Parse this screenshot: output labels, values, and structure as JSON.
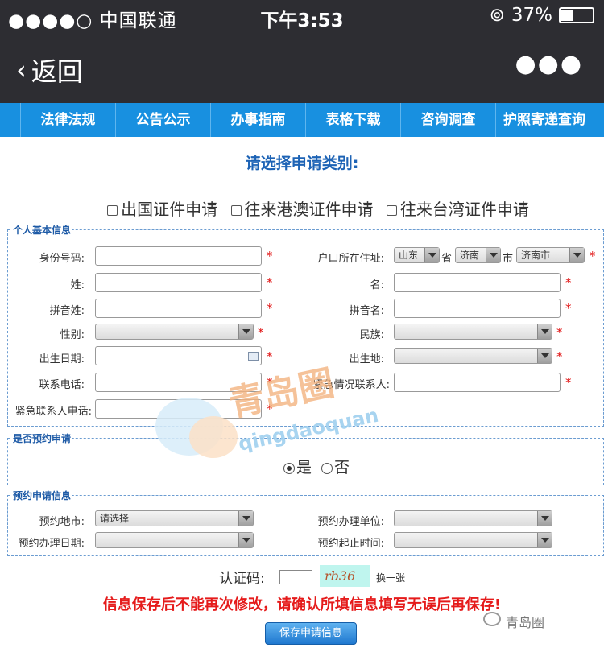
{
  "status": {
    "carrier": "●●●●○ 中国联通",
    "time": "下午3:53",
    "battery": "37%",
    "battery_level": 0.37
  },
  "nav": {
    "back_label": "返回",
    "more_label": "●●●"
  },
  "menu": [
    "法律法规",
    "公告公示",
    "办事指南",
    "表格下载",
    "咨询调查",
    "护照寄递查询"
  ],
  "page_title": "请选择申请类别:",
  "types": [
    "出国证件申请",
    "往来港澳证件申请",
    "往来台湾证件申请"
  ],
  "personal": {
    "legend": "个人基本信息",
    "id_label": "身份号码:",
    "hukou_label": "户口所在住址:",
    "province": "山东",
    "province_unit": "省",
    "city": "济南",
    "city_unit": "市",
    "district": "济南市",
    "surname_label": "姓:",
    "name_label": "名:",
    "pinyin_surname_label": "拼音姓:",
    "pinyin_name_label": "拼音名:",
    "gender_label": "性别:",
    "ethnicity_label": "民族:",
    "birthdate_label": "出生日期:",
    "birthplace_label": "出生地:",
    "phone_label": "联系电话:",
    "emergency_contact_label": "紧急情况联系人:",
    "emergency_phone_label": "紧急联系人电话:",
    "required": "*"
  },
  "reservation": {
    "legend": "是否预约申请",
    "yes": "是",
    "no": "否"
  },
  "reservation_info": {
    "legend": "预约申请信息",
    "place_label": "预约地市:",
    "place_value": "请选择",
    "unit_label": "预约办理单位:",
    "date_label": "预约办理日期:",
    "time_label": "预约起止时间:"
  },
  "captcha": {
    "label": "认证码:",
    "code": "rb36",
    "refresh": "换一张"
  },
  "warning": "信息保存后不能再次修改，请确认所填信息填写无误后再保存!",
  "save_label": "保存申请信息",
  "watermark": {
    "brand": "青岛圈",
    "logo_text": "青岛圈",
    "logo_sub": "qingdaoquan"
  },
  "colors": {
    "menu_bar": "#1890e0",
    "header": "#2d2d32",
    "title": "#1d63b5",
    "warning": "#e51b1b",
    "required": "#e01010"
  }
}
